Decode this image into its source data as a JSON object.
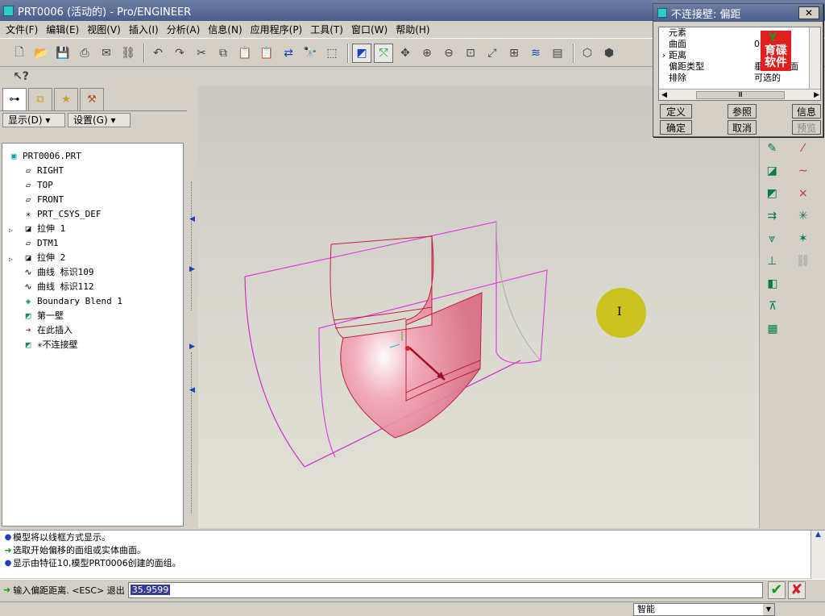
{
  "window": {
    "title": "PRT0006 (活动的) - Pro/ENGINEER"
  },
  "menu": [
    "文件(F)",
    "编辑(E)",
    "视图(V)",
    "插入(I)",
    "分析(A)",
    "信息(N)",
    "应用程序(P)",
    "工具(T)",
    "窗口(W)",
    "帮助(H)"
  ],
  "panel": {
    "display_button": "显示(D) ▾",
    "settings_button": "设置(G) ▾",
    "tree": [
      {
        "label": "PRT0006.PRT",
        "icon": "part-icon",
        "glyph": "▣",
        "level": 0,
        "expander": ""
      },
      {
        "label": "RIGHT",
        "icon": "datum-plane-icon",
        "glyph": "▱",
        "level": 1,
        "expander": ""
      },
      {
        "label": "TOP",
        "icon": "datum-plane-icon",
        "glyph": "▱",
        "level": 1,
        "expander": ""
      },
      {
        "label": "FRONT",
        "icon": "datum-plane-icon",
        "glyph": "▱",
        "level": 1,
        "expander": ""
      },
      {
        "label": "PRT_CSYS_DEF",
        "icon": "csys-icon",
        "glyph": "✳",
        "level": 1,
        "expander": ""
      },
      {
        "label": "拉伸 1",
        "icon": "extrude-icon",
        "glyph": "◪",
        "level": 1,
        "expander": "▷"
      },
      {
        "label": "DTM1",
        "icon": "datum-plane-icon",
        "glyph": "▱",
        "level": 1,
        "expander": ""
      },
      {
        "label": "拉伸 2",
        "icon": "extrude-icon",
        "glyph": "◪",
        "level": 1,
        "expander": "▷"
      },
      {
        "label": "曲线 标识109",
        "icon": "curve-icon",
        "glyph": "∿",
        "level": 1,
        "expander": ""
      },
      {
        "label": "曲线 标识112",
        "icon": "curve-icon",
        "glyph": "∿",
        "level": 1,
        "expander": ""
      },
      {
        "label": "Boundary Blend 1",
        "icon": "boundary-blend-icon",
        "glyph": "◈",
        "level": 1,
        "expander": ""
      },
      {
        "label": "第一壁",
        "icon": "wall-icon",
        "glyph": "◩",
        "level": 1,
        "expander": ""
      },
      {
        "label": "在此插入",
        "icon": "insert-here-arrow-icon",
        "glyph": "➜",
        "level": 1,
        "expander": ""
      },
      {
        "label": "✳不连接壁",
        "icon": "wall-icon",
        "glyph": "◩",
        "level": 1,
        "expander": ""
      }
    ]
  },
  "dialog": {
    "title": "不连接壁: 偏距",
    "close": "✕",
    "rows": [
      {
        "element": "元素",
        "info": "",
        "selected": ""
      },
      {
        "element": "曲面",
        "info": "0的",
        "selected": ""
      },
      {
        "element": "距离",
        "info": "",
        "selected": "›"
      },
      {
        "element": "偏距类型",
        "info": "垂直于曲面",
        "selected": ""
      },
      {
        "element": "排除",
        "info": "可选的",
        "selected": ""
      }
    ],
    "watermark": "育碟\n软件",
    "scroll_thumb": "Ⅲ",
    "buttons": {
      "define": "定义",
      "reference": "参照",
      "info": "信息",
      "ok": "确定",
      "cancel": "取消",
      "preview": "预览"
    }
  },
  "messages": [
    {
      "type": "bullet",
      "text": "模型将以线框方式显示。"
    },
    {
      "type": "arrow",
      "text": "选取开始偏移的面组或实体曲面。"
    },
    {
      "type": "bullet",
      "text": "显示由特征10,模型PRT0006创建的面组。"
    }
  ],
  "input": {
    "prompt": "输入偏距距离. <ESC> 退出",
    "value": "35.9599"
  },
  "status": {
    "filter": "智能"
  }
}
